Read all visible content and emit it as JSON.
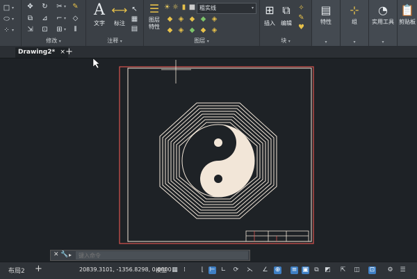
{
  "ribbon": {
    "modify_title": "修改",
    "annotation_title": "注释",
    "layers_title": "图层",
    "block_title": "块",
    "text_label": "文字",
    "dimension_label": "标注",
    "layer_props_label": "图层特性",
    "layer_combo_value": "粗实线",
    "insert_label": "插入",
    "edit_label": "编辑",
    "properties_label": "特性",
    "group_label": "组",
    "utilities_label": "实用工具",
    "clipboard_label": "剪贴板"
  },
  "tabs": {
    "document_tab": "Drawing2*",
    "close_glyph": "×",
    "new_tab_glyph": "+"
  },
  "command": {
    "placeholder": "键入命令"
  },
  "status": {
    "layout_tab": "布局2",
    "add_layout": "+",
    "coordinates": "20839.3101, -1356.8298, 0.0000",
    "model_label": "模型"
  },
  "colors": {
    "ribbon_bg": "#3b4046",
    "canvas_bg": "#1e2226",
    "drawing_line": "#f2e6d8",
    "border_red": "#d9534f",
    "accent_blue": "#3f7fc4"
  },
  "icons": [
    "move-icon",
    "rotate-icon",
    "trim-icon",
    "copy-icon",
    "mirror-icon",
    "fillet-icon",
    "stretch-icon",
    "scale-icon",
    "array-icon",
    "erase-icon",
    "explode-icon",
    "offset-icon",
    "text-icon",
    "dimension-icon",
    "leader-icon",
    "table-icon",
    "layer-properties-icon",
    "insert-icon",
    "block-edit-icon",
    "properties-icon",
    "group-icon",
    "measure-icon",
    "clipboard-icon"
  ]
}
